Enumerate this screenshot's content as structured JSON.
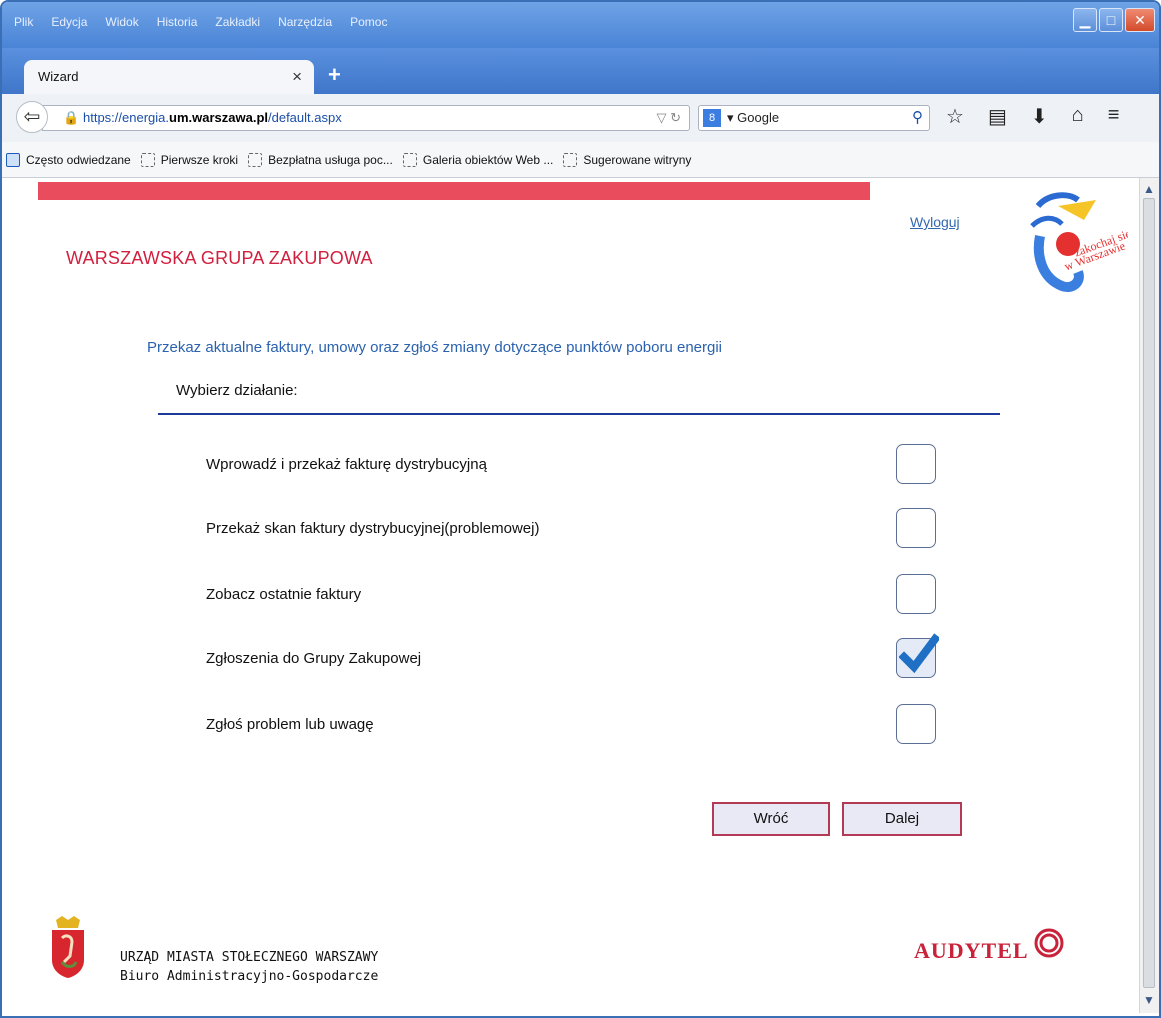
{
  "menu": [
    "Plik",
    "Edycja",
    "Widok",
    "Historia",
    "Zakładki",
    "Narzędzia",
    "Pomoc"
  ],
  "tab": {
    "title": "Wizard",
    "close": "×",
    "new_tab": "+"
  },
  "address": {
    "scheme": "https://",
    "sub": "energia.",
    "host": "um.warszawa.pl",
    "path": "/default.aspx"
  },
  "search": {
    "engine": "Google",
    "engine_icon": "8"
  },
  "bookmarks": [
    "Często odwiedzane",
    "Pierwsze kroki",
    "Bezpłatna usługa poc...",
    "Galeria obiektów Web ...",
    "Sugerowane witryny"
  ],
  "page": {
    "logout": "Wyloguj",
    "org_title": "WARSZAWSKA GRUPA ZAKUPOWA",
    "subtitle": "Przekaz aktualne faktury, umowy oraz zgłoś zmiany dotyczące punktów poboru energii",
    "choose_label": "Wybierz działanie:",
    "options": [
      {
        "label": "Wprowadź i przekaż fakturę dystrybucyjną",
        "checked": false
      },
      {
        "label": "Przekaż skan faktury dystrybucyjnej(problemowej)",
        "checked": false
      },
      {
        "label": "Zobacz ostatnie faktury",
        "checked": false
      },
      {
        "label": "Zgłoszenia do Grupy Zakupowej",
        "checked": true
      },
      {
        "label": "Zgłoś problem lub uwagę",
        "checked": false
      }
    ],
    "back_button": "Wróć",
    "next_button": "Dalej",
    "footer_line1": "URZĄD MIASTA STOŁECZNEGO WARSZAWY",
    "footer_line2": "Biuro Administracyjno-Gospodarcze",
    "audytel": "AUDYTEL"
  },
  "colors": {
    "accent": "#d21f3e",
    "link": "#3268b0",
    "divider": "#1d3a9a",
    "checkmark": "#1f6fc4"
  }
}
